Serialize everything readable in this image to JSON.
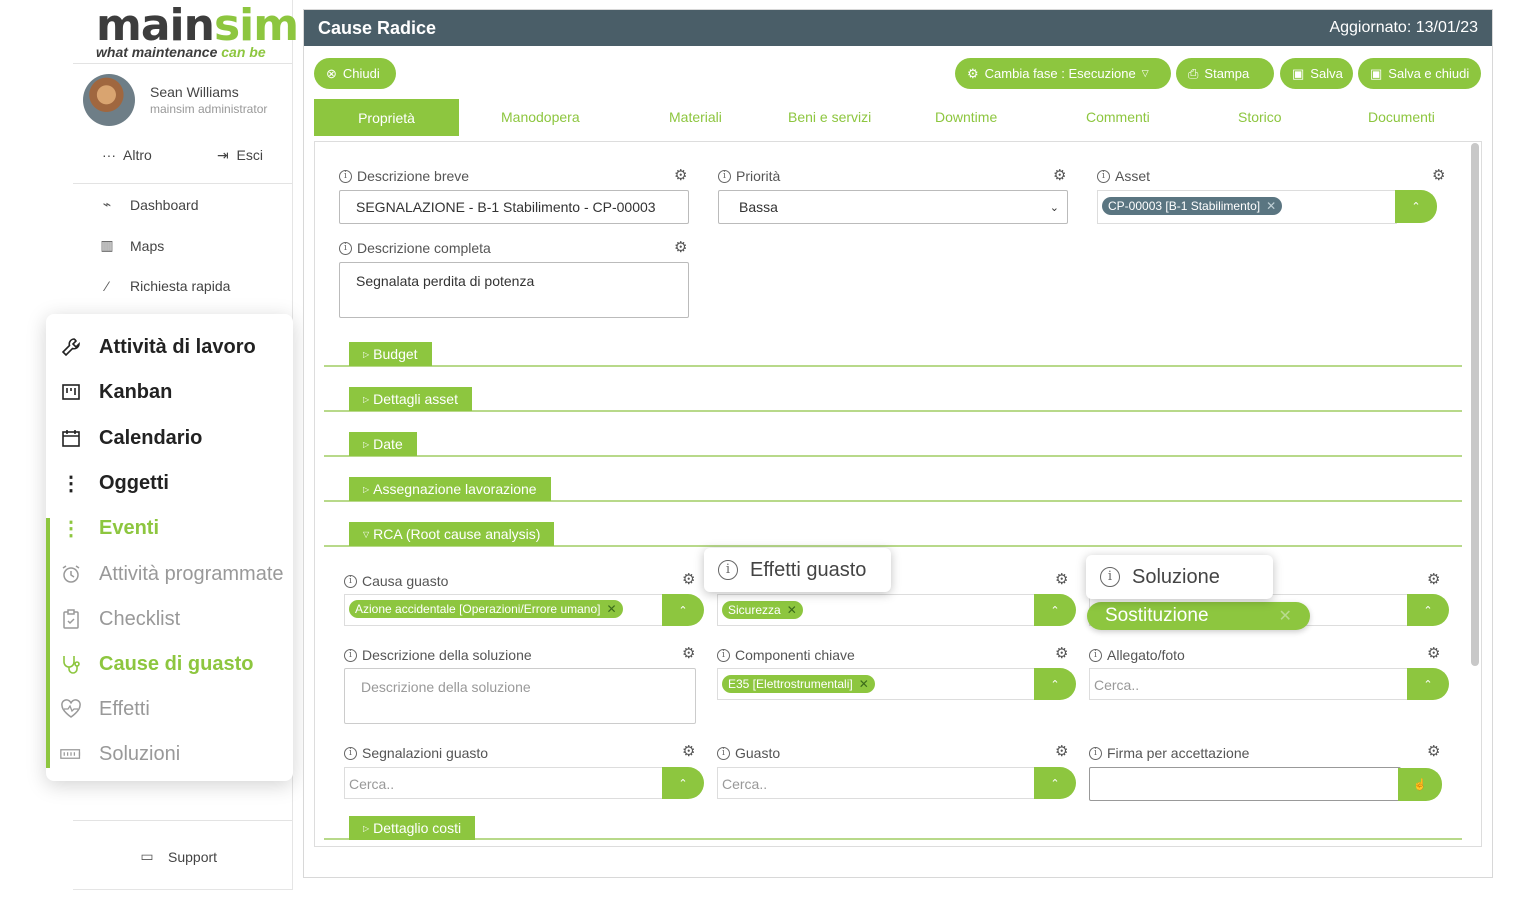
{
  "brand": {
    "name_dark": "main",
    "name_green": "sim",
    "tagline_dark": "what maintenance",
    "tagline_green": "can be"
  },
  "user": {
    "name": "Sean Williams",
    "role": "mainsim administrator"
  },
  "user_actions": {
    "more": "Altro",
    "logout": "Esci"
  },
  "nav": [
    {
      "label": "Dashboard",
      "icon": "chart-icon"
    },
    {
      "label": "Maps",
      "icon": "map-icon"
    },
    {
      "label": "Richiesta rapida",
      "icon": "magic-wand-icon"
    }
  ],
  "popmenu": [
    {
      "label": "Attività di lavoro",
      "icon": "wrench-icon",
      "style": "dark"
    },
    {
      "label": "Kanban",
      "icon": "kanban-icon",
      "style": "dark"
    },
    {
      "label": "Calendario",
      "icon": "calendar-icon",
      "style": "dark"
    },
    {
      "label": "Oggetti",
      "icon": "more-vertical-icon",
      "style": "dark"
    },
    {
      "label": "Eventi",
      "icon": "more-vertical-icon",
      "style": "green"
    },
    {
      "label": "Attività programmate",
      "icon": "alarm-clock-icon",
      "style": "gray"
    },
    {
      "label": "Checklist",
      "icon": "clipboard-icon",
      "style": "gray"
    },
    {
      "label": "Cause di guasto",
      "icon": "stethoscope-icon",
      "style": "green"
    },
    {
      "label": "Effetti",
      "icon": "heart-pulse-icon",
      "style": "gray"
    },
    {
      "label": "Soluzioni",
      "icon": "battery-icon",
      "style": "gray"
    }
  ],
  "support": "Support",
  "header": {
    "title": "Cause Radice",
    "updated": "Aggiornato: 13/01/23"
  },
  "toolbar": {
    "close": "Chiudi",
    "phase": "Cambia fase : Esecuzione",
    "print": "Stampa",
    "save": "Salva",
    "save_close": "Salva e chiudi"
  },
  "tabs": [
    "Proprietà",
    "Manodopera",
    "Materiali",
    "Beni e servizi",
    "Downtime",
    "Commenti",
    "Storico",
    "Documenti"
  ],
  "form": {
    "short_desc_label": "Descrizione breve",
    "short_desc_value": "SEGNALAZIONE - B-1 Stabilimento - CP-00003",
    "priority_label": "Priorità",
    "priority_value": "Bassa",
    "asset_label": "Asset",
    "asset_chip": "CP-00003 [B-1 Stabilimento]",
    "full_desc_label": "Descrizione completa",
    "full_desc_value": "Segnalata perdita di potenza"
  },
  "sections": {
    "budget": "Budget",
    "asset_details": "Dettagli asset",
    "date": "Date",
    "assignment": "Assegnazione lavorazione",
    "rca": "RCA (Root cause analysis)",
    "costs": "Dettaglio costi"
  },
  "rca": {
    "cause_label": "Causa guasto",
    "cause_chip": "Azione accidentale [Operazioni/Errore umano]",
    "effects_chip": "Sicurezza",
    "solution_chip": "Sostituzione",
    "sol_desc_label": "Descrizione della soluzione",
    "sol_desc_placeholder": "Descrizione della soluzione",
    "components_label": "Componenti chiave",
    "components_chip": "E35 [Elettrostrumentali]",
    "attachment_label": "Allegato/foto",
    "attachment_placeholder": "Cerca..",
    "reports_label": "Segnalazioni guasto",
    "reports_placeholder": "Cerca..",
    "failure_label": "Guasto",
    "failure_placeholder": "Cerca..",
    "signature_label": "Firma per accettazione"
  },
  "tooltips": {
    "effects": "Effetti guasto",
    "solution": "Soluzione"
  },
  "colors": {
    "accent": "#8dc63f",
    "header": "#4a5e68",
    "chip_slate": "#5a7581"
  }
}
